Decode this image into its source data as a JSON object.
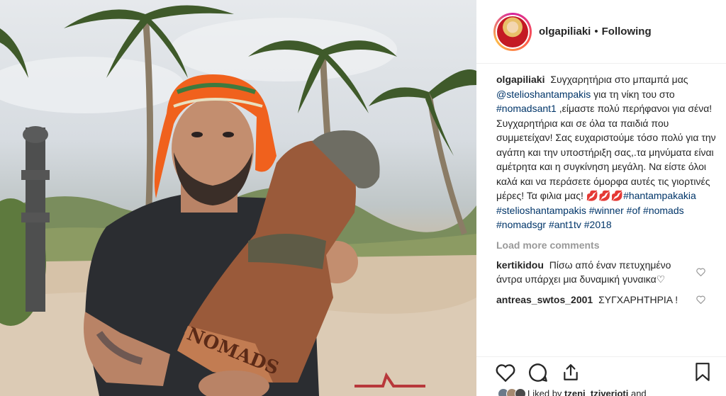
{
  "post": {
    "username": "olgapiliaki",
    "separator": "•",
    "follow_status": "Following",
    "photo_carving_text": "NOMADS"
  },
  "caption": {
    "username": "olgapiliaki",
    "part1": "Συγχαρητήρια στο μπαμπά μας",
    "mention": "@stelioshantampakis",
    "part2": "για τη νίκη του στο",
    "tag1": "#nomadsant1",
    "part3": ",είμαστε πολύ περήφανοι για σένα! Συγχαρητήρια και σε όλα τα παιδιά που συμμετείχαν! Σας ευχαριστούμε τόσο πολύ για την αγάπη και την υποστήριξη σας,.τα μηνύματα είναι αμέτρητα και η συγκίνηση μεγάλη. Να είστε όλοι καλά και να περάσετε όμορφα αυτές τις γιορτινές μέρες! Τα φιλια μας!",
    "emoji": "💋💋💋",
    "tags": [
      "#hantampakakia",
      "#stelioshantampakis",
      "#winner",
      "#of",
      "#nomads",
      "#nomadsgr",
      "#ant1tv",
      "#2018"
    ]
  },
  "load_more_label": "Load more comments",
  "comments": [
    {
      "username": "kertikidou",
      "text": "Πίσω από έναν πετυχημένο άντρα υπάρχει μια δυναμική γυναικα♡"
    },
    {
      "username": "antreas_swtos_2001",
      "text": "ΣΥΓΧΑΡΗΤΗΡΙΑ !"
    }
  ],
  "likes": {
    "prefix": "Liked by",
    "user": "tzeni_tziverioti",
    "suffix": "and"
  },
  "icons": {
    "like": "heart-icon",
    "comment": "comment-icon",
    "share": "share-icon",
    "save": "bookmark-icon",
    "comment_like": "heart-small-icon"
  },
  "colors": {
    "link": "#003569",
    "muted": "#999999",
    "text": "#262626"
  }
}
